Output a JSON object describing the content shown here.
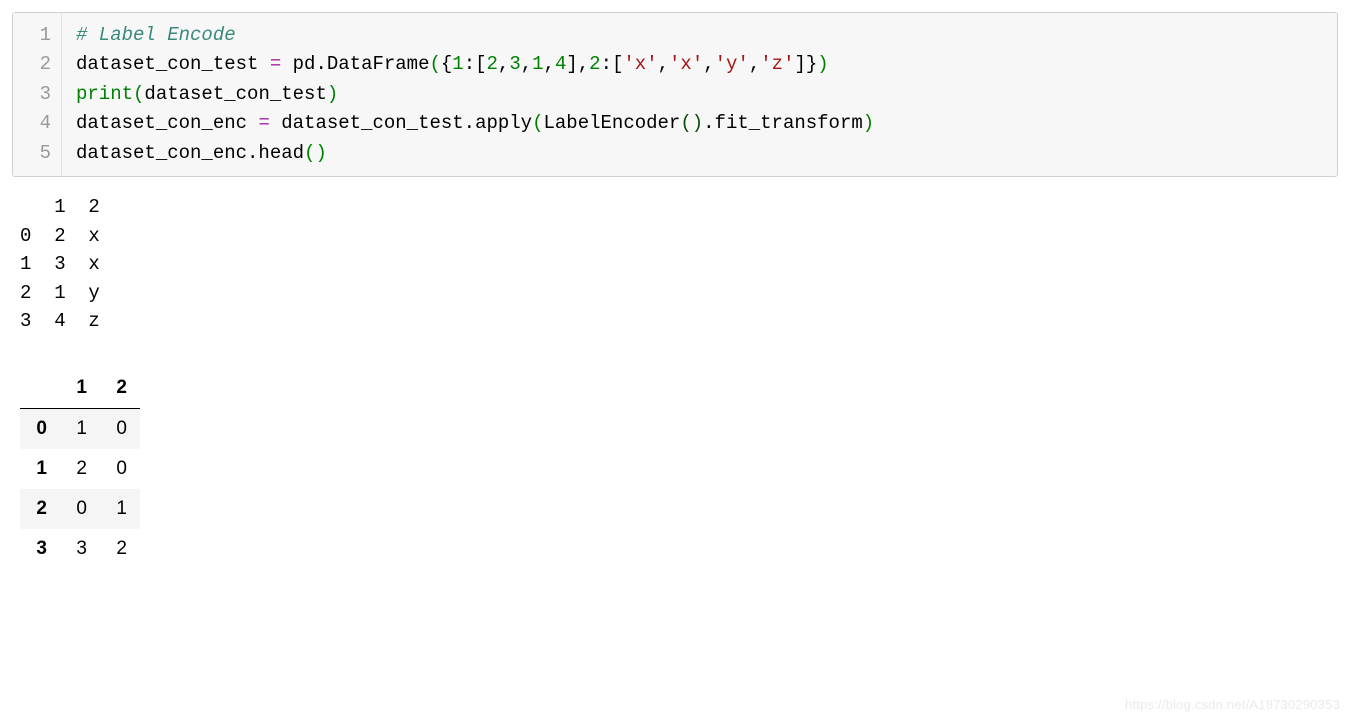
{
  "code": {
    "lines": [
      "1",
      "2",
      "3",
      "4",
      "5"
    ],
    "l1_comment": "# Label Encode",
    "l2_a": "dataset_con_test ",
    "l2_eq": "=",
    "l2_b": " pd.DataFrame",
    "l2_p1": "(",
    "l2_c": "{",
    "l2_n1": "1",
    "l2_colon1": ":[",
    "l2_n2": "2",
    "l2_com1": ",",
    "l2_n3": "3",
    "l2_com2": ",",
    "l2_n4": "1",
    "l2_com3": ",",
    "l2_n5": "4",
    "l2_close1": "],",
    "l2_n6": "2",
    "l2_colon2": ":[",
    "l2_s1": "'x'",
    "l2_com4": ",",
    "l2_s2": "'x'",
    "l2_com5": ",",
    "l2_s3": "'y'",
    "l2_com6": ",",
    "l2_s4": "'z'",
    "l2_close2": "]}",
    "l2_p2": ")",
    "l3_print": "print",
    "l3_p1": "(",
    "l3_arg": "dataset_con_test",
    "l3_p2": ")",
    "l4_a": "dataset_con_enc ",
    "l4_eq": "=",
    "l4_b": " dataset_con_test.apply",
    "l4_p1": "(",
    "l4_c": "LabelEncoder",
    "l4_p2": "()",
    "l4_d": ".fit_transform",
    "l4_p3": ")",
    "l5_a": "dataset_con_enc.head",
    "l5_p": "()"
  },
  "stdout": "   1  2\n0  2  x\n1  3  x\n2  1  y\n3  4  z",
  "df": {
    "cols": [
      "1",
      "2"
    ],
    "rows": [
      {
        "idx": "0",
        "c1": "1",
        "c2": "0"
      },
      {
        "idx": "1",
        "c1": "2",
        "c2": "0"
      },
      {
        "idx": "2",
        "c1": "0",
        "c2": "1"
      },
      {
        "idx": "3",
        "c1": "3",
        "c2": "2"
      }
    ]
  },
  "watermark": "https://blog.csdn.net/A18730290353"
}
